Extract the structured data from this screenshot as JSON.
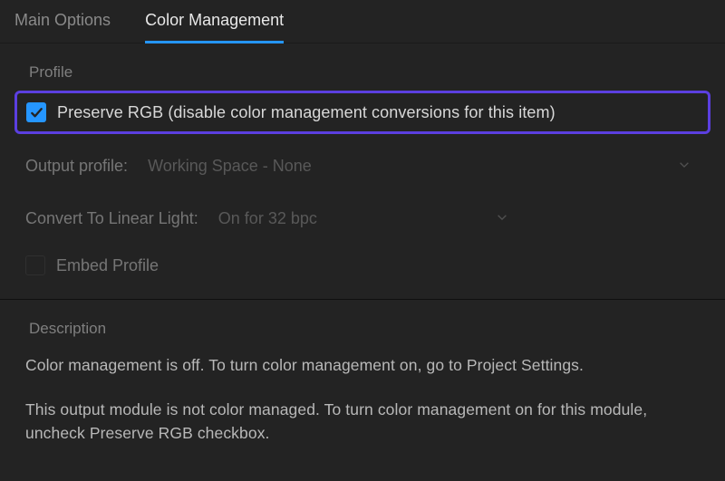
{
  "tabs": {
    "main_options": "Main Options",
    "color_management": "Color Management"
  },
  "profile": {
    "section_title": "Profile",
    "preserve_rgb_label": "Preserve RGB (disable color management conversions for this item)",
    "preserve_rgb_checked": true,
    "output_profile_label": "Output profile:",
    "output_profile_value": "Working Space - None",
    "convert_linear_label": "Convert To Linear Light:",
    "convert_linear_value": "On for 32 bpc",
    "embed_profile_label": "Embed Profile",
    "embed_profile_checked": false
  },
  "description": {
    "section_title": "Description",
    "line1": "Color management is off. To turn color management on, go to Project Settings.",
    "line2": "This output module is not color managed. To turn color management on for this module, uncheck Preserve RGB checkbox."
  },
  "colors": {
    "accent": "#2596ff",
    "highlight_border": "#5b3fe0"
  }
}
